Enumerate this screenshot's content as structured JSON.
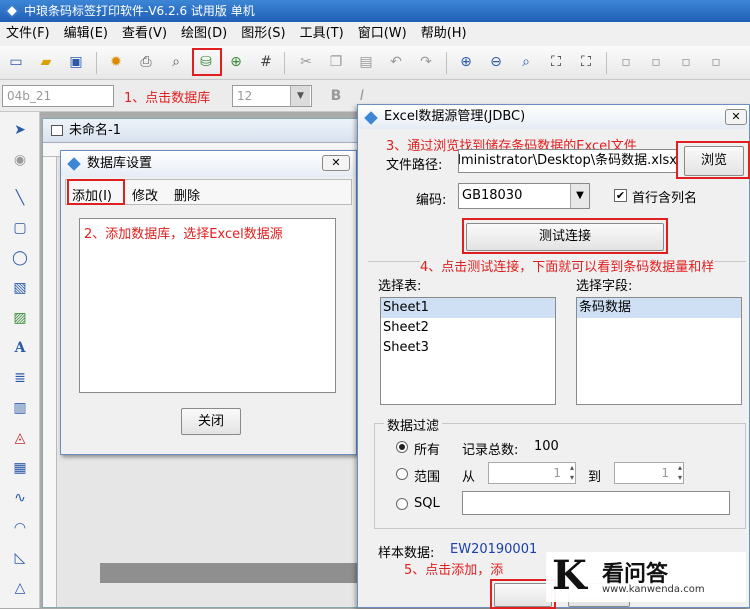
{
  "app": {
    "title": "中琅条码标签打印软件-V6.2.6 试用版 单机"
  },
  "menu": [
    "文件(F)",
    "编辑(E)",
    "查看(V)",
    "绘图(D)",
    "图形(S)",
    "工具(T)",
    "窗口(W)",
    "帮助(H)"
  ],
  "toolbar2": {
    "font_value": "04b_21",
    "size_value": "12"
  },
  "annotations": {
    "step1": "1、点击数据库",
    "step2": "2、添加数据库，选择Excel数据源",
    "step3": "3、通过浏览找到储存条码数据的Excel文件",
    "step4": "4、点击测试连接，下面就可以看到条码数据量和样",
    "step5": "5、点击添加，添"
  },
  "document": {
    "title": "未命名-1"
  },
  "db_dialog": {
    "title": "数据库设置",
    "add": "添加(I)",
    "modify": "修改",
    "delete": "删除",
    "close": "关闭"
  },
  "excel_dialog": {
    "title": "Excel数据源管理(JDBC)",
    "path_label": "文件路径:",
    "path_value": "dministrator\\Desktop\\条码数据.xlsx",
    "browse": "浏览",
    "encoding_label": "编码:",
    "encoding_value": "GB18030",
    "header_checkbox": "首行含列名",
    "header_checked": true,
    "test_button": "测试连接",
    "sheet_label": "选择表:",
    "sheets": [
      "Sheet1",
      "Sheet2",
      "Sheet3"
    ],
    "field_label": "选择字段:",
    "fields": [
      "条码数据"
    ],
    "filter_group": "数据过滤",
    "opt_all": "所有",
    "total_label": "记录总数:",
    "total_value": "100",
    "opt_range": "范围",
    "from_label": "从",
    "from_value": "1",
    "to_label": "到",
    "to_value": "1",
    "opt_sql": "SQL",
    "sample_label": "样本数据:",
    "sample_value": "EW20190001"
  },
  "watermark": {
    "logo": "K",
    "title": "看问答",
    "url": "www.kanwenda.com"
  }
}
